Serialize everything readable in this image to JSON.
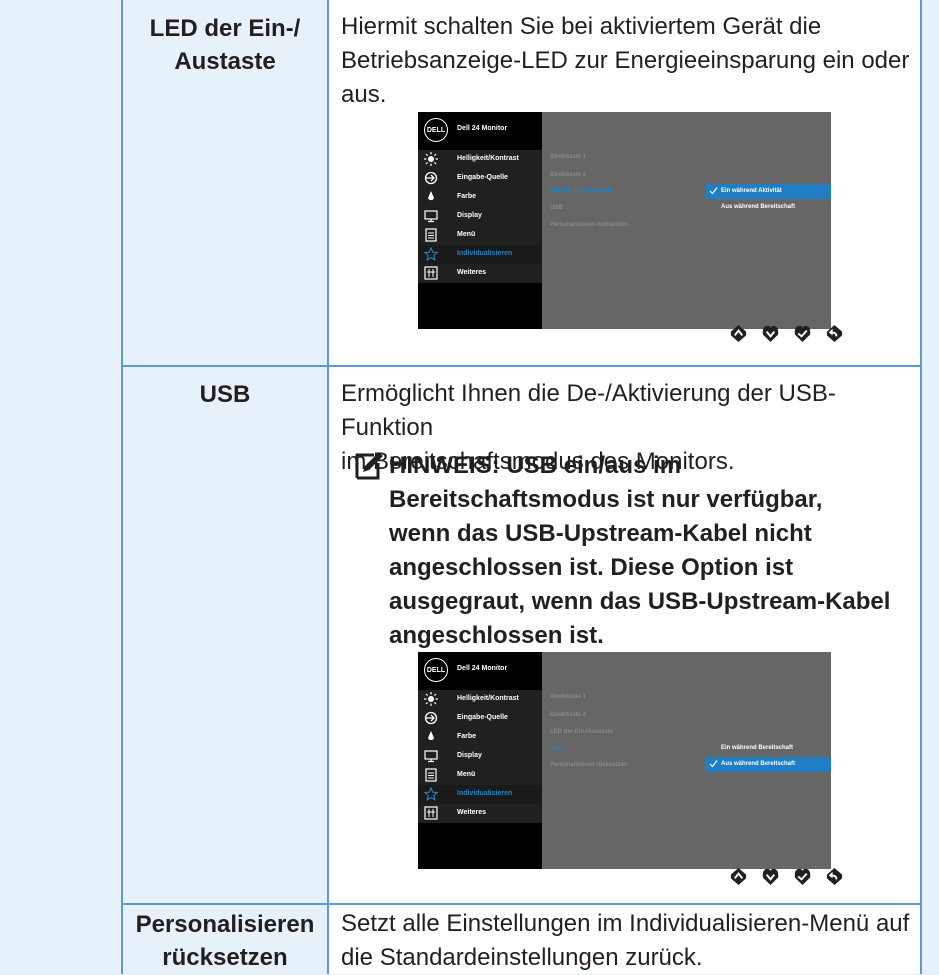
{
  "rows": [
    {
      "label": "LED der Ein-/\nAustaste",
      "label_lines": [
        "LED der Ein-/",
        "Austaste"
      ],
      "desc_lines": [
        "Hiermit schalten Sie bei aktiviertem Gerät die",
        "Betriebsanzeige-LED zur Energieeinsparung ein oder",
        "aus."
      ]
    },
    {
      "label_lines": [
        "USB"
      ],
      "desc_lines": [
        "Ermöglicht Ihnen die De-/Aktivierung der USB-Funktion",
        "im Bereitschaftsmodus des Monitors."
      ],
      "note_lines": [
        "HINWEIS: USB ein/aus im",
        "Bereitschaftsmodus ist nur verfügbar,",
        "wenn das USB-Upstream-Kabel nicht",
        "angeschlossen ist. Diese Option ist",
        "ausgegraut, wenn das USB-Upstream-Kabel",
        "angeschlossen ist."
      ]
    },
    {
      "label_lines": [
        "Personalisieren",
        "rücksetzen"
      ],
      "desc_lines": [
        "Setzt alle Einstellungen im Individualisieren-Menü auf",
        "die Standardeinstellungen zurück."
      ]
    }
  ],
  "osd": {
    "logo": "DELL",
    "title": "Dell 24 Monitor",
    "menu": [
      {
        "label": "Helligkeit/Kontrast",
        "icon": "brightness-icon"
      },
      {
        "label": "Eingabe-Quelle",
        "icon": "input-source-icon"
      },
      {
        "label": "Farbe",
        "icon": "color-icon"
      },
      {
        "label": "Display",
        "icon": "display-icon"
      },
      {
        "label": "Menü",
        "icon": "menu-icon"
      },
      {
        "label": "Individualisieren",
        "icon": "star-icon"
      },
      {
        "label": "Weiteres",
        "icon": "others-icon"
      }
    ],
    "sub": [
      "Direkttaste 1",
      "Direkttaste 2",
      "LED der Ein-/Austaste",
      "USB",
      "Personalisieren rücksetzen"
    ],
    "osd1_options": [
      "Ein während Aktivität",
      "Aus während Bereitschaft"
    ],
    "osd2_options": [
      "Ein während Bereitschaft",
      "Aus während Bereitschaft"
    ]
  },
  "colors": {
    "border": "#5b9bd5",
    "label_bg": "#e6f1f9",
    "accent": "#1f7ec4"
  }
}
